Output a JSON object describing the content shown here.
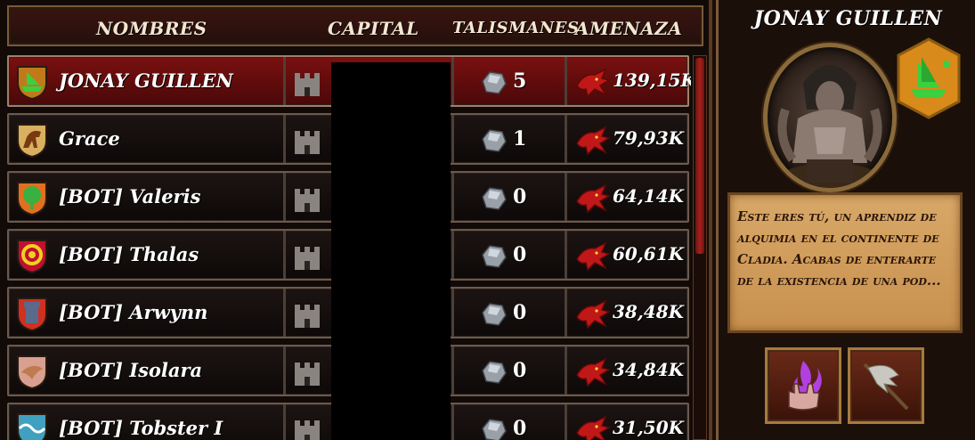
{
  "header": {
    "names": "Nombres",
    "capital": "Capital",
    "talismans": "Talismanes",
    "threat": "Amenaza"
  },
  "rows": [
    {
      "name": "JONAY GUILLEN",
      "talismans": "5",
      "threat": "139,15K",
      "selected": true,
      "crest_color": "#c07a1a",
      "crest_icon": "ship-icon"
    },
    {
      "name": "Grace",
      "talismans": "1",
      "threat": "79,93K",
      "selected": false,
      "crest_color": "#d8b060",
      "crest_icon": "horse-icon"
    },
    {
      "name": "[BOT] Valeris",
      "talismans": "0",
      "threat": "64,14K",
      "selected": false,
      "crest_color": "#e07020",
      "crest_icon": "tree-icon"
    },
    {
      "name": "[BOT] Thalas",
      "talismans": "0",
      "threat": "60,61K",
      "selected": false,
      "crest_color": "#c01030",
      "crest_icon": "sun-icon"
    },
    {
      "name": "[BOT] Arwynn",
      "talismans": "0",
      "threat": "38,48K",
      "selected": false,
      "crest_color": "#d03020",
      "crest_icon": "tower-icon"
    },
    {
      "name": "[BOT] Isolara",
      "talismans": "0",
      "threat": "34,84K",
      "selected": false,
      "crest_color": "#d8a090",
      "crest_icon": "bird-icon"
    },
    {
      "name": "[BOT] Tobster I",
      "talismans": "0",
      "threat": "31,50K",
      "selected": false,
      "crest_color": "#40a0c0",
      "crest_icon": "wave-icon"
    }
  ],
  "info": {
    "player_name": "JONAY GUILLEN",
    "description": "Este eres tú, un aprendiz de alquimia en el continente de Cladia. Acabas de enterarte de la existencia de una pod..."
  },
  "colors": {
    "selected_row": "#7a1010",
    "accent_gold": "#a87a3e",
    "parchment": "#d8a868"
  }
}
